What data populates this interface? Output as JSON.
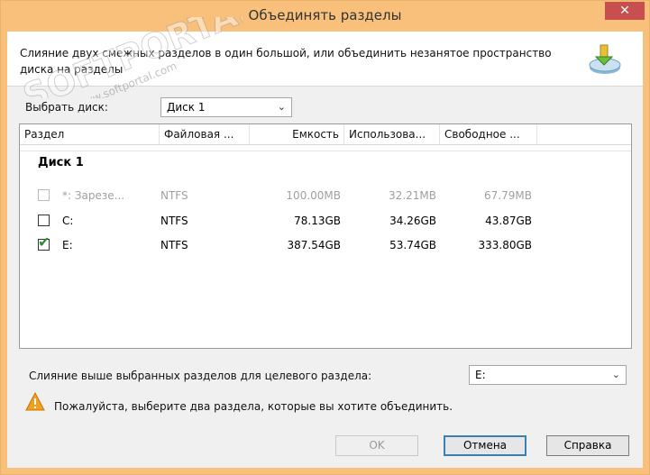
{
  "window": {
    "title": "Объединять разделы",
    "close_label": "✕"
  },
  "header": {
    "description": "Слияние двух смежных разделов в один большой, или объединить незанятое пространство диска на разделы"
  },
  "disk_select": {
    "label": "Выбрать диск:",
    "value": "Диск 1"
  },
  "table": {
    "columns": [
      "Раздел",
      "Файловая ...",
      "Емкость",
      "Использова...",
      "Свободное ..."
    ],
    "group": "Диск 1",
    "rows": [
      {
        "partition": "*: Зарезе...",
        "fs": "NTFS",
        "capacity": "100.00MB",
        "used": "32.21MB",
        "free": "67.79MB",
        "checked": false,
        "disabled": true
      },
      {
        "partition": "C:",
        "fs": "NTFS",
        "capacity": "78.13GB",
        "used": "34.26GB",
        "free": "43.87GB",
        "checked": false,
        "disabled": false
      },
      {
        "partition": "E:",
        "fs": "NTFS",
        "capacity": "387.54GB",
        "used": "53.74GB",
        "free": "333.80GB",
        "checked": true,
        "disabled": false
      }
    ]
  },
  "target": {
    "label": "Слияние выше выбранных разделов для целевого раздела:",
    "value": "E:"
  },
  "warning": {
    "text": "Пожалуйста, выберите два раздела, которые вы хотите объединить."
  },
  "buttons": {
    "ok": "OK",
    "cancel": "Отмена",
    "help": "Справка"
  },
  "watermark": {
    "text": "SOFTPORTAL",
    "url": "www.softportal.com"
  },
  "colors": {
    "title_bar": "#f8c07a",
    "close_button": "#c7504f",
    "checkmark": "#2e8d2e",
    "warning": "#f0a020"
  }
}
